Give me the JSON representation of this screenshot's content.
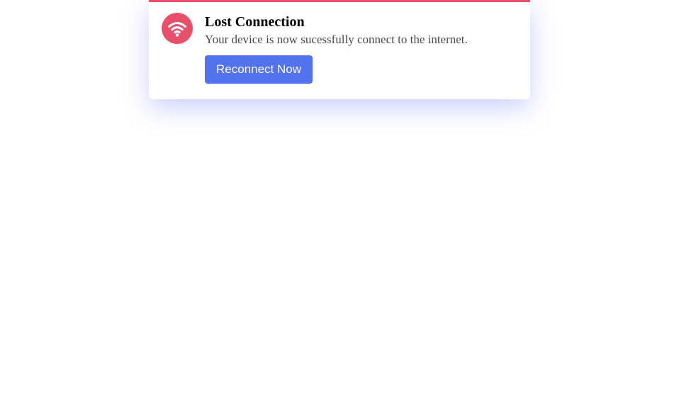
{
  "toast": {
    "title": "Lost Connection",
    "message": "Your device is now sucessfully connect to the internet.",
    "button_label": "Reconnect Now",
    "icon": "wifi-icon"
  },
  "colors": {
    "accent": "#e84f6a",
    "button": "#5372f0",
    "shadow": "#4a5af0",
    "background": "#ffffff"
  }
}
